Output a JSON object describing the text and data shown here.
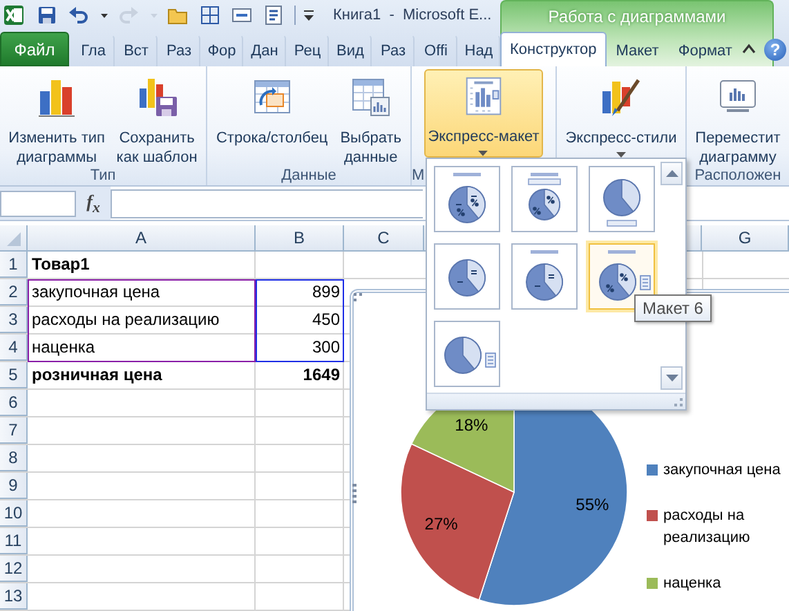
{
  "title_bar": {
    "quick_access": [
      {
        "kind": "save",
        "disabled": false
      },
      {
        "kind": "undo",
        "disabled": false
      },
      {
        "kind": "dropdown",
        "disabled": false
      },
      {
        "kind": "redo",
        "disabled": true
      },
      {
        "kind": "dropdown",
        "disabled": true
      },
      {
        "kind": "open",
        "disabled": false
      },
      {
        "kind": "borders",
        "disabled": false
      },
      {
        "kind": "textbox",
        "disabled": false
      },
      {
        "kind": "form",
        "disabled": false
      },
      {
        "kind": "customize",
        "disabled": false
      }
    ],
    "title": "Книга1  -  Microsoft E...",
    "context_group": "Работа с диаграммами"
  },
  "tabs": [
    {
      "label": "Файл",
      "kind": "file",
      "selected": false
    },
    {
      "label": "Гла",
      "kind": "main",
      "selected": false
    },
    {
      "label": "Вст",
      "kind": "main",
      "selected": false
    },
    {
      "label": "Раз",
      "kind": "main",
      "selected": false
    },
    {
      "label": "Фор",
      "kind": "main",
      "selected": false
    },
    {
      "label": "Дан",
      "kind": "main",
      "selected": false
    },
    {
      "label": "Рец",
      "kind": "main",
      "selected": false
    },
    {
      "label": "Вид",
      "kind": "main",
      "selected": false
    },
    {
      "label": "Раз",
      "kind": "main",
      "selected": false
    },
    {
      "label": "Offi",
      "kind": "main",
      "selected": false
    },
    {
      "label": "Над",
      "kind": "main",
      "selected": false
    },
    {
      "label": "Конструктор",
      "kind": "context",
      "selected": true
    },
    {
      "label": "Макет",
      "kind": "context",
      "selected": false
    },
    {
      "label": "Формат",
      "kind": "context",
      "selected": false
    }
  ],
  "help": "?",
  "ribbon": {
    "groups": [
      {
        "label": "Тип",
        "buttons": [
          {
            "label": "Изменить тип\nдиаграммы",
            "kind": "change-type"
          },
          {
            "label": "Сохранить\nкак шаблон",
            "kind": "save-template"
          }
        ]
      },
      {
        "label": "Данные",
        "buttons": [
          {
            "label": "Строка/столбец",
            "kind": "switch-row-column"
          },
          {
            "label": "Выбрать\nданные",
            "kind": "select-data"
          }
        ]
      },
      {
        "label": "М",
        "buttons": [
          {
            "label": "Экспресс-макет",
            "kind": "quick-layout",
            "expanded": true
          }
        ]
      },
      {
        "buttons": [
          {
            "label": "Экспресс-стили",
            "kind": "quick-styles",
            "expanded": false
          }
        ]
      },
      {
        "label": "Расположен",
        "buttons": [
          {
            "label": "Переместит\nдиаграмму",
            "kind": "move-chart"
          }
        ]
      }
    ]
  },
  "formula_bar": {
    "function_button": "f$_{x}$"
  },
  "sheet": {
    "columns": [
      {
        "label": "A"
      },
      {
        "label": "B"
      },
      {
        "label": "C"
      },
      {
        "label": "G"
      }
    ],
    "rows": [
      {
        "number": "1",
        "A": "Товар1",
        "bold": true
      },
      {
        "number": "2",
        "A": "закупочная цена",
        "B": "899",
        "bold": false,
        "in_range": true
      },
      {
        "number": "3",
        "A": "расходы на реализацию",
        "B": "450",
        "bold": false,
        "in_range": true
      },
      {
        "number": "4",
        "A": "наценка",
        "B": "300",
        "bold": false,
        "in_range": true
      },
      {
        "number": "5",
        "A": "розничная цена",
        "B": "1649",
        "bold": true
      },
      {
        "number": "6"
      },
      {
        "number": "7"
      },
      {
        "number": "8"
      },
      {
        "number": "9"
      },
      {
        "number": "10"
      },
      {
        "number": "11"
      },
      {
        "number": "12"
      },
      {
        "number": "13"
      }
    ]
  },
  "gallery": {
    "items": [
      {
        "kind": "mixed",
        "highlighted": false
      },
      {
        "kind": "toplegend",
        "highlighted": false
      },
      {
        "kind": "bottomlegend",
        "highlighted": false
      },
      {
        "kind": "dashed",
        "highlighted": false
      },
      {
        "kind": "titleddashed",
        "highlighted": false
      },
      {
        "kind": "rightlegend",
        "highlighted": true
      },
      {
        "kind": "plainlegend",
        "highlighted": false
      }
    ]
  },
  "tooltip": "Макет 6",
  "chart": {
    "chart_data": {
      "type": "pie",
      "values": [
        55,
        27,
        18
      ],
      "value_labels": [
        "55%",
        "27%",
        "18%"
      ]
    },
    "legend": [
      {
        "label": "закупочная цена",
        "color": "#4f81bd"
      },
      {
        "label": "расходы на реализацию",
        "color": "#c0504d"
      },
      {
        "label": "наценка",
        "color": "#9bbb59"
      }
    ]
  }
}
